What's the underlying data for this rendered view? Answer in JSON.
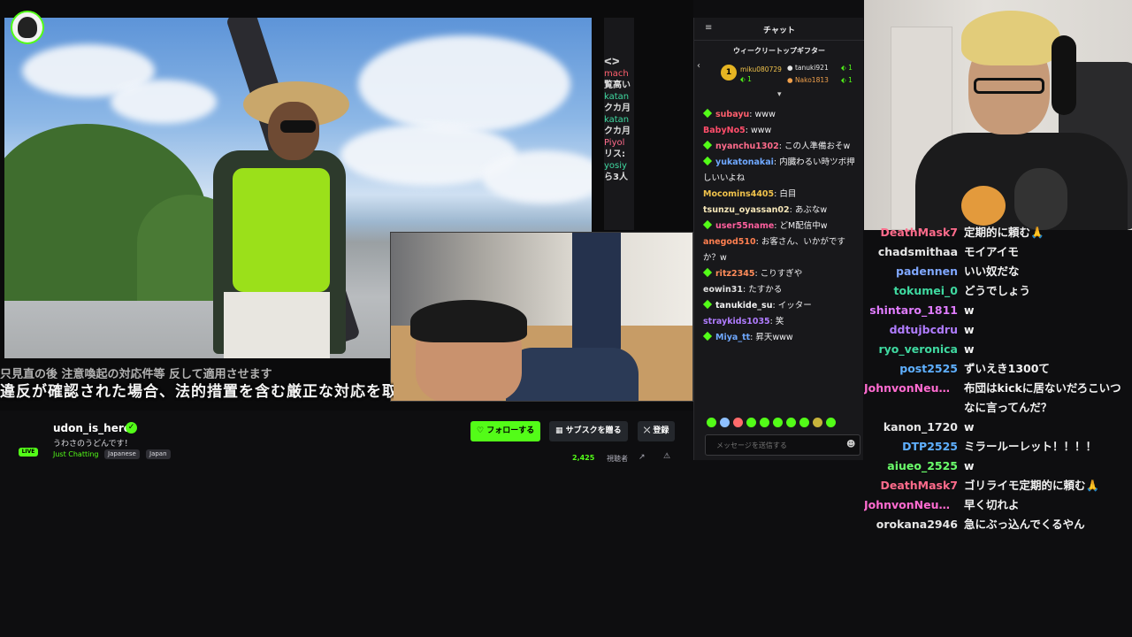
{
  "video": {
    "side_strip_lines": [
      "ᐸᐳ",
      "mach",
      "覧高い",
      "katan",
      "クカ月",
      "katan",
      "クカ月",
      "Piyol",
      "リス:",
      "yosiy",
      "ら3人"
    ],
    "subtitle_top": "只見直の後 注意喚起の対応件等 反して適用させます",
    "subtitle": "違反が確認された場合、法的措置を含む厳正な対応を取り"
  },
  "channel": {
    "name": "udon_is_here",
    "title": "うわさのうどんです！",
    "category": "Just Chatting",
    "tags": [
      "Japanese",
      "Japan"
    ],
    "live_label": "LIVE",
    "follow_label": "♡ フォローする",
    "gift_sub_label": "▦ サブスクを贈る",
    "subscribe_label": "⤫ 登録",
    "viewer_count": "2,425",
    "viewer_label": "視聴者",
    "share_icon": "↗",
    "report_icon": "⚠"
  },
  "chat": {
    "title": "チャット",
    "collapse_icon": "≡",
    "gifters_title": "ウィークリートップギフター",
    "back_icon": "‹",
    "top_gifter_rank": "1",
    "gifters": [
      {
        "name": "miku080729",
        "count": "1"
      },
      {
        "name": "tanuki921",
        "count": "1"
      },
      {
        "name": "Nako1813",
        "count": "1"
      }
    ],
    "expand_icon": "▾",
    "messages": [
      {
        "user": "subayu",
        "color": "#ff5f6d",
        "badge": true,
        "text": "www"
      },
      {
        "user": "BabyNo5",
        "color": "#ff4d6a",
        "badge": false,
        "text": "www"
      },
      {
        "user": "nyanchu1302",
        "color": "#ff6b8b",
        "badge": true,
        "text": "この人準備おそw"
      },
      {
        "user": "yukatonakai",
        "color": "#6fa8ff",
        "badge": true,
        "text": "内臓わるい時ツボ押しいいよね"
      },
      {
        "user": "Mocomins4405",
        "color": "#f0c24b",
        "badge": false,
        "text": "白目"
      },
      {
        "user": "tsunzu_oyassan02",
        "color": "#f5e6b8",
        "badge": false,
        "text": "あぶなw"
      },
      {
        "user": "user55name",
        "color": "#ff5f9e",
        "badge": true,
        "text": "どM配信中w"
      },
      {
        "user": "anegod510",
        "color": "#ff7f50",
        "badge": false,
        "text": "お客さん、いかがですか？w"
      },
      {
        "user": "ritz2345",
        "color": "#ff8c5a",
        "badge": true,
        "text": "こりすぎや"
      },
      {
        "user": "eowin31",
        "color": "#e0e0e0",
        "badge": false,
        "text": "たすかる"
      },
      {
        "user": "tanukide_su",
        "color": "#f2f2f2",
        "badge": true,
        "text": "イッター"
      },
      {
        "user": "straykids1035",
        "color": "#b07cff",
        "badge": false,
        "text": "笑"
      },
      {
        "user": "Miya_tt",
        "color": "#6fa8ff",
        "badge": true,
        "text": "昇天www"
      }
    ],
    "input_placeholder": "メッセージを送信する",
    "emoji_icon": "☻"
  },
  "overlay_chat": [
    {
      "user": "DeathMask7",
      "color": "#ff6b8b",
      "text": "定期的に頼む🙏"
    },
    {
      "user": "chadsmithaa",
      "color": "#e6e6e6",
      "text": "モイアイモ"
    },
    {
      "user": "padennen",
      "color": "#7fa7ff",
      "text": "いい奴だな"
    },
    {
      "user": "tokumei_0",
      "color": "#3fd9a0",
      "text": "どうでしょう"
    },
    {
      "user": "shintaro_1811",
      "color": "#e07cff",
      "text": "w"
    },
    {
      "user": "ddtujbcdru",
      "color": "#b07cff",
      "text": "w"
    },
    {
      "user": "ryo_veronica",
      "color": "#3fd9a0",
      "text": "w"
    },
    {
      "user": "post2525",
      "color": "#5fb0ff",
      "text": "ずいえき1300て"
    },
    {
      "user": "JohnvonNeuma...",
      "color": "#ff6bd0",
      "text": "布団はkickに居ないだろこいつなに言ってんだ？"
    },
    {
      "user": "kanon_1720",
      "color": "#e6e6e6",
      "text": "w"
    },
    {
      "user": "DTP2525",
      "color": "#5fb0ff",
      "text": "ミラールーレット！！！！"
    },
    {
      "user": "aiueo_2525",
      "color": "#6bff6b",
      "text": "w"
    },
    {
      "user": "DeathMask7",
      "color": "#ff6b8b",
      "text": "ゴリライモ定期的に頼む🙏"
    },
    {
      "user": "JohnvonNeuma...",
      "color": "#ff6bd0",
      "text": "早く切れよ"
    },
    {
      "user": "orokana2946",
      "color": "#e6e6e6",
      "text": "急にぶっ込んでくるやん"
    }
  ]
}
